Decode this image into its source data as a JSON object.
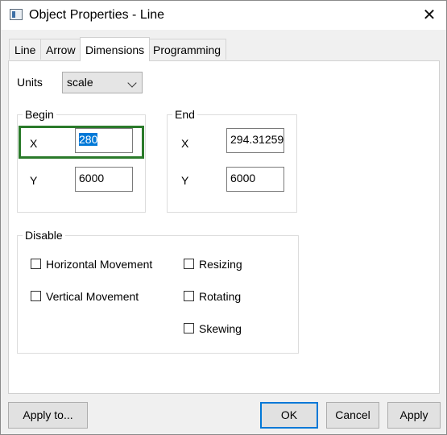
{
  "window": {
    "title": "Object Properties - Line",
    "icon": "line-object-icon",
    "close_icon": "close-icon",
    "close_glyph": "✕"
  },
  "tabs": [
    {
      "label": "Line",
      "active": false
    },
    {
      "label": "Arrow",
      "active": false
    },
    {
      "label": "Dimensions",
      "active": true
    },
    {
      "label": "Programming",
      "active": false
    }
  ],
  "units": {
    "label": "Units",
    "value": "scale"
  },
  "begin": {
    "title": "Begin",
    "x_label": "X",
    "x_value": "280",
    "y_label": "Y",
    "y_value": "6000"
  },
  "end": {
    "title": "End",
    "x_label": "X",
    "x_value": "294.31259",
    "y_label": "Y",
    "y_value": "6000"
  },
  "disable": {
    "title": "Disable",
    "options": [
      {
        "label": "Horizontal Movement",
        "checked": false
      },
      {
        "label": "Vertical Movement",
        "checked": false
      },
      {
        "label": "Resizing",
        "checked": false
      },
      {
        "label": "Rotating",
        "checked": false
      },
      {
        "label": "Skewing",
        "checked": false
      }
    ]
  },
  "buttons": {
    "apply_to": "Apply to...",
    "ok": "OK",
    "cancel": "Cancel",
    "apply": "Apply"
  },
  "colors": {
    "accent": "#0078d7",
    "highlight": "#2a7a2a"
  }
}
